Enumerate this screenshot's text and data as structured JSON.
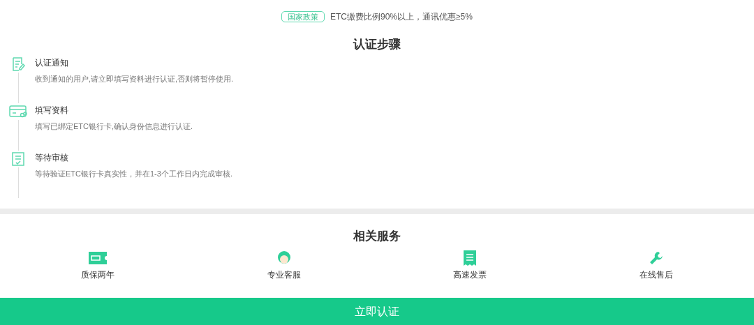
{
  "banner": {
    "badge": "国家政策",
    "text": "ETC缴费比例90%以上，通讯优惠≥5%"
  },
  "steps_title": "认证步骤",
  "steps": [
    {
      "kind": "note",
      "title": "认证通知",
      "text": "收到通知的用户,请立即填写资料进行认证,否则将暂停使用."
    },
    {
      "kind": "card",
      "title": "填写资料",
      "text": "填写已绑定ETC银行卡,确认身份信息进行认证."
    },
    {
      "kind": "check",
      "title": "等待审核",
      "text": "等待验证ETC银行卡真实性，并在1-3个工作日内完成审核."
    }
  ],
  "services_title": "相关服务",
  "services": [
    {
      "kind": "warranty",
      "label": "质保两年"
    },
    {
      "kind": "support",
      "label": "专业客服"
    },
    {
      "kind": "invoice",
      "label": "高速发票"
    },
    {
      "kind": "repair",
      "label": "在线售后"
    }
  ],
  "submit": "立即认证"
}
